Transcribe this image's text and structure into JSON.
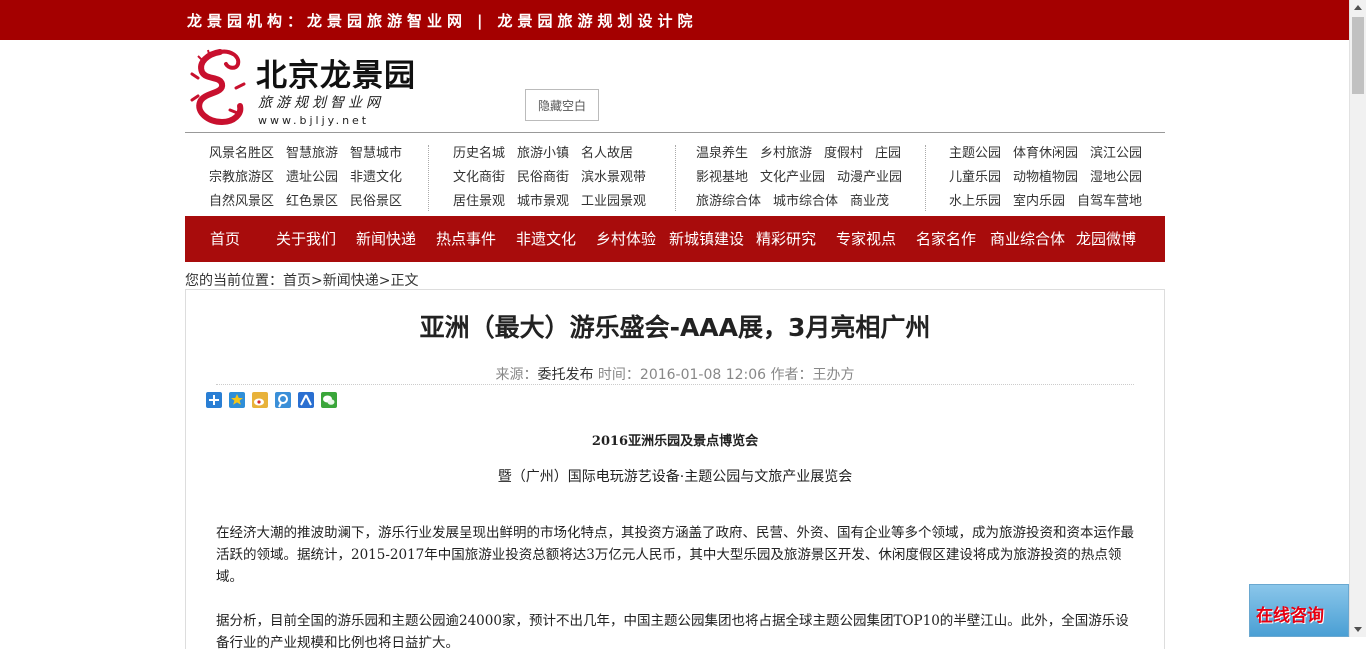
{
  "topbar": {
    "org_label": "龙景园机构：",
    "site1": "龙景园旅游智业网",
    "separator": "|",
    "site2": "龙景园旅游规划设计院"
  },
  "logo": {
    "title": "北京龙景园",
    "subtitle": "旅游规划智业网",
    "url": "www.bjljy.net"
  },
  "hide_button": "隐藏空白",
  "category_groups": [
    [
      [
        "风景名胜区",
        "智慧旅游",
        "智慧城市"
      ],
      [
        "宗教旅游区",
        "遗址公园",
        "非遗文化"
      ],
      [
        "自然风景区",
        "红色景区",
        "民俗景区"
      ]
    ],
    [
      [
        "历史名城",
        "旅游小镇",
        "名人故居"
      ],
      [
        "文化商街",
        "民俗商街",
        "滨水景观带"
      ],
      [
        "居住景观",
        "城市景观",
        "工业园景观"
      ]
    ],
    [
      [
        "温泉养生",
        "乡村旅游",
        "度假村",
        "庄园"
      ],
      [
        "影视基地",
        "文化产业园",
        "动漫产业园"
      ],
      [
        "旅游综合体",
        "城市综合体",
        "商业茂"
      ]
    ],
    [
      [
        "主题公园",
        "体育休闲园",
        "滨江公园"
      ],
      [
        "儿童乐园",
        "动物植物园",
        "湿地公园"
      ],
      [
        "水上乐园",
        "室内乐园",
        "自驾车营地"
      ]
    ]
  ],
  "main_nav": [
    "首页",
    "关于我们",
    "新闻快递",
    "热点事件",
    "非遗文化",
    "乡村体验",
    "新城镇建设",
    "精彩研究",
    "专家视点",
    "名家名作",
    "商业综合体",
    "龙园微博"
  ],
  "breadcrumb": {
    "prefix": "您的当前位置：",
    "home": "首页",
    "section": "新闻快递",
    "current": "正文",
    "sep": ">"
  },
  "article": {
    "title": "亚洲（最大）游乐盛会-AAA展，3月亮相广州",
    "meta_source_label": "来源：",
    "meta_source": "委托发布",
    "meta_rest": " 时间：2016-01-08 12:06 作者：王办方",
    "heading1": "2016亚洲乐园及景点博览会",
    "heading2": "暨（广州）国际电玩游艺设备·主题公园与文旅产业展览会",
    "para1": "在经济大潮的推波助澜下，游乐行业发展呈现出鲜明的市场化特点，其投资方涵盖了政府、民营、外资、国有企业等多个领域，成为旅游投资和资本运作最活跃的领域。据统计，2015-2017年中国旅游业投资总额将达3万亿元人民币，其中大型乐园及旅游景区开发、休闲度假区建设将成为旅游投资的热点领域。",
    "para2": "据分析，目前全国的游乐园和主题公园逾24000家，预计不出几年，中国主题公园集团也将占据全球主题公园集团TOP10的半壁江山。此外，全国游乐设备行业的产业规模和比例也将日益扩大。"
  },
  "consult_label": "在线咨询",
  "colors": {
    "brand_red": "#a40000",
    "nav_red": "#a80c0c"
  }
}
